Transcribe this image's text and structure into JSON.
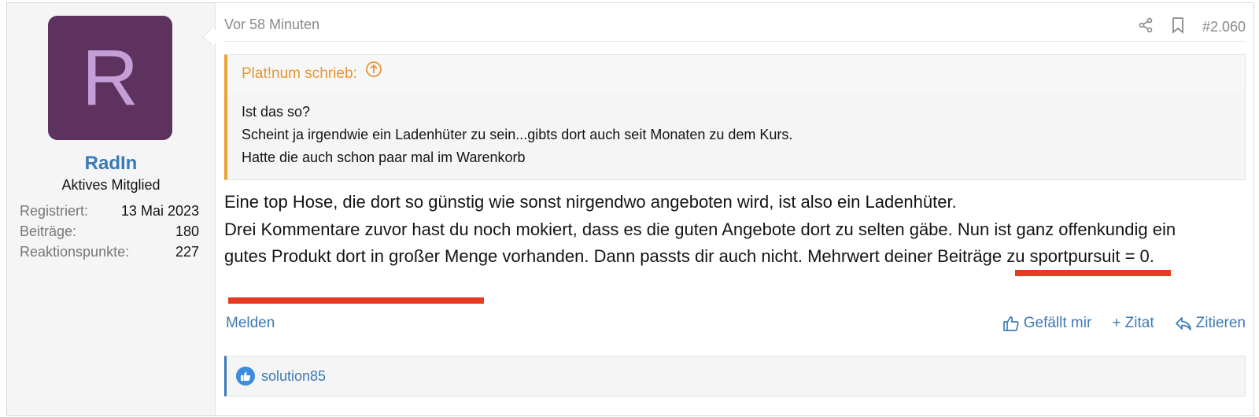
{
  "author": {
    "avatar_letter": "R",
    "username": "RadIn",
    "title": "Aktives Mitglied",
    "stats": [
      {
        "label": "Registriert:",
        "value": "13 Mai 2023"
      },
      {
        "label": "Beiträge:",
        "value": "180"
      },
      {
        "label": "Reaktionspunkte:",
        "value": "227"
      }
    ]
  },
  "meta": {
    "time": "Vor 58 Minuten",
    "post_number": "#2.060",
    "share_icon": "share-icon",
    "bookmark_icon": "bookmark-icon"
  },
  "quote": {
    "author": "Plat!num schrieb:",
    "lines": [
      "Ist das so?",
      "Scheint ja irgendwie ein Ladenhüter zu sein...gibts dort auch seit Monaten zu dem Kurs.",
      "Hatte die auch schon paar mal im Warenkorb"
    ]
  },
  "body": {
    "line1": "Eine top Hose, die dort so günstig wie sonst nirgendwo angeboten wird, ist also ein Ladenhüter.",
    "line2": "Drei Kommentare zuvor hast du noch mokiert, dass es die guten Angebote dort zu selten gäbe. Nun ist ganz offenkundig ein gutes Produkt dort in großer Menge vorhanden. Dann passts dir auch nicht. Mehrwert deiner Beiträge zu sportpursuit = 0."
  },
  "actions": {
    "report": "Melden",
    "like": "Gefällt mir",
    "quote_plus": "+ Zitat",
    "reply": "Zitieren"
  },
  "likes": {
    "user": "solution85"
  },
  "colors": {
    "link": "#3b7ab8",
    "quote_accent": "#e8a33a",
    "avatar_bg": "#5d325e",
    "annotation_red": "#e63b23"
  }
}
